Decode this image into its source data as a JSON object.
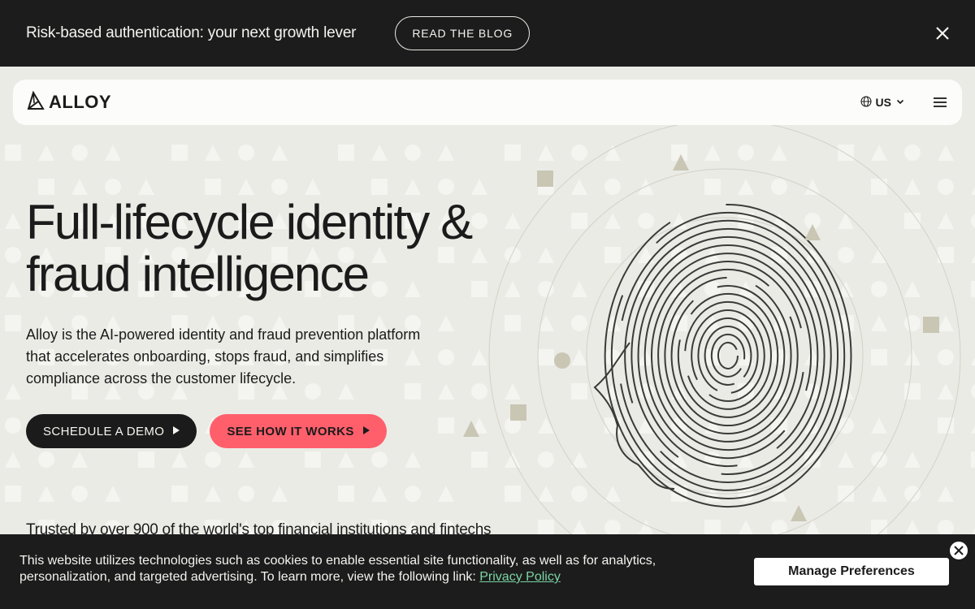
{
  "announcement": {
    "text": "Risk-based authentication: your next growth lever",
    "button_label": "READ THE BLOG",
    "close_icon": "close-icon"
  },
  "navbar": {
    "logo_text": "ALLOY",
    "locale_label": "US",
    "globe_icon": "globe-icon",
    "chevron_icon": "chevron-down-icon",
    "menu_icon": "hamburger-menu-icon"
  },
  "hero": {
    "title_line1": "Full-lifecycle identity &",
    "title_line2": "fraud intelligence",
    "description": "Alloy is the AI-powered identity and fraud prevention platform that accelerates onboarding, stops fraud, and simplifies compliance across the customer lifecycle.",
    "cta_primary": "SCHEDULE A DEMO",
    "cta_secondary": "SEE HOW IT WORKS",
    "trusted_text": "Trusted by over 900 of the world's top financial institutions and fintechs"
  },
  "cookie_banner": {
    "text": "This website utilizes technologies such as cookies to enable essential site functionality, as well as for analytics, personalization, and targeted advertising. To learn more, view the following link:",
    "link_label": "Privacy Policy",
    "manage_button": "Manage Preferences"
  },
  "colors": {
    "dark": "#1c1c1c",
    "background": "#ebebe6",
    "accent_pink": "#ff5f6b",
    "link_green": "#7bd4a3",
    "shape_taupe": "#c9c6b4"
  }
}
